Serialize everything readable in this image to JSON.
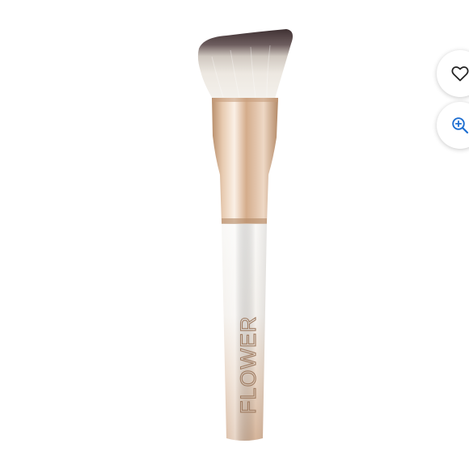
{
  "product": {
    "brand_logo_text": "FLOWER",
    "image_name": "flower-kabuki-foundation-brush"
  },
  "actions": {
    "wishlist_icon": "heart-outline-icon",
    "zoom_icon": "zoom-in-icon"
  },
  "colors": {
    "bristle_dark": "#4b3b3d",
    "bristle_light": "#ede8e1",
    "ferrule_rose_gold": "#d9b595",
    "handle_top": "#f7f6f3",
    "handle_bottom": "#d8b99f",
    "icon_heart": "#222222",
    "icon_zoom": "#1f6fd1"
  }
}
